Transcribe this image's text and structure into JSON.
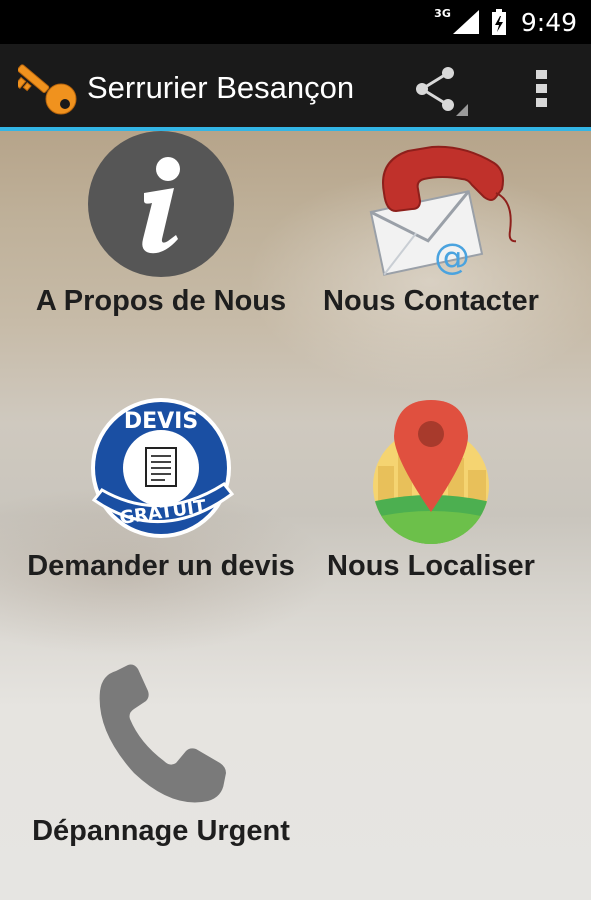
{
  "status_bar": {
    "network": "3G",
    "time": "9:49"
  },
  "action_bar": {
    "title": "Serrurier Besançon",
    "app_icon": "key-icon",
    "share_icon": "share-icon",
    "overflow_icon": "overflow-menu-icon"
  },
  "tiles": [
    {
      "label": "A Propos de Nous",
      "icon": "info-icon"
    },
    {
      "label": "Nous Contacter",
      "icon": "phone-email-icon"
    },
    {
      "label": "Demander un devis",
      "icon": "devis-gratuit-badge-icon",
      "badge_top": "DEVIS",
      "badge_bottom": "GRATUIT"
    },
    {
      "label": "Nous Localiser",
      "icon": "map-pin-icon"
    },
    {
      "label": "Dépannage Urgent",
      "icon": "phone-handset-icon"
    }
  ],
  "colors": {
    "action_bar_bg": "#1a1a1a",
    "accent_line": "#33b5e5",
    "key_orange": "#f0921e",
    "label_text": "#1e1e1e"
  }
}
